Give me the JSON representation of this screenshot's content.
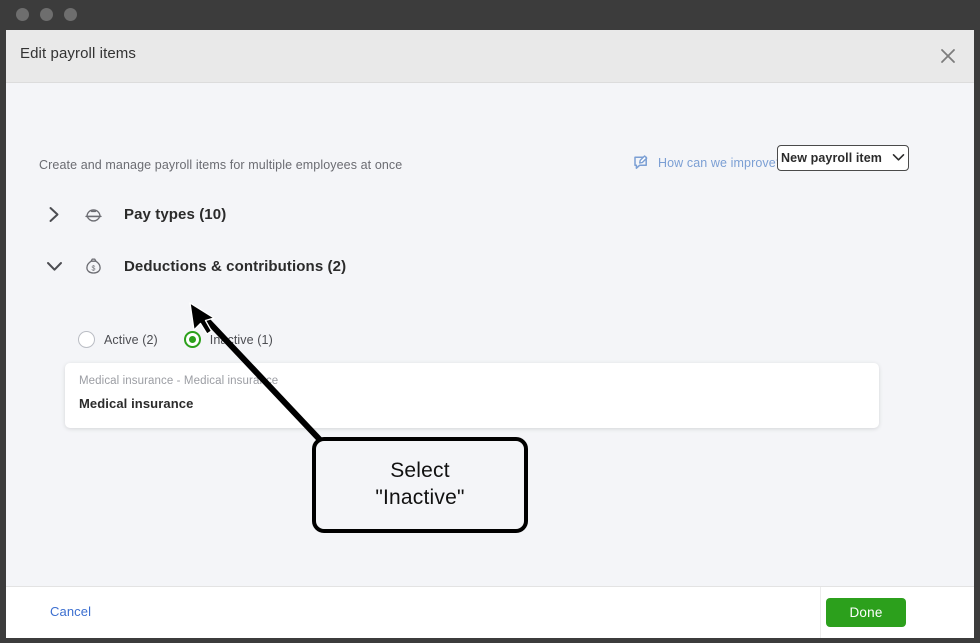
{
  "window": {
    "traffic_lights": [
      "close",
      "minimize",
      "maximize"
    ]
  },
  "sheet": {
    "title": "Edit payroll items",
    "close_icon": "close-icon",
    "subtitle": "Create and manage payroll items for multiple employees at once",
    "improve_link": {
      "label": "How can we improve?",
      "icon": "feedback-comment-edit-icon",
      "color": "#7b9fd4"
    },
    "new_item_button": {
      "label": "New payroll item",
      "icon": "chevron-down-icon"
    }
  },
  "sections": [
    {
      "label": "Pay types (10)",
      "icon": "hard-hat-icon",
      "caret": "chevron-right-icon",
      "expanded": false
    },
    {
      "label": "Deductions & contributions (2)",
      "icon": "money-bag-dollar-icon",
      "caret": "chevron-down-icon",
      "expanded": true
    }
  ],
  "filter": {
    "options": [
      {
        "label": "Active (2)",
        "selected": false
      },
      {
        "label": "Inactive (1)",
        "selected": true
      }
    ],
    "selected_color": "#2ca01c"
  },
  "items": [
    {
      "subtitle": "Medical insurance - Medical insurance",
      "title": "Medical insurance"
    }
  ],
  "footer": {
    "cancel_label": "Cancel",
    "done_label": "Done",
    "done_color": "#2ca01c",
    "cancel_color": "#3c6fd0"
  },
  "annotation": {
    "line1": "Select",
    "line2": "\"Inactive\"",
    "pointer": "cursor-arrow"
  }
}
